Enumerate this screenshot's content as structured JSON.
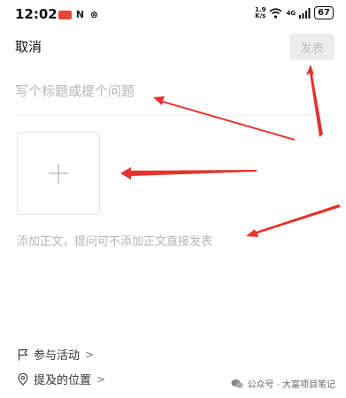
{
  "status_bar": {
    "time": "12:02",
    "notif_n": "N",
    "notif_x": "⊗",
    "speed_top": "1.9",
    "speed_bottom": "K/s",
    "network": "4G",
    "battery": "67"
  },
  "header": {
    "cancel_label": "取消",
    "publish_label": "发表"
  },
  "editor": {
    "title_placeholder": "写个标题或提个问题",
    "body_placeholder": "添加正文，提问可不添加正文直接发表"
  },
  "options": {
    "activity_label": "参与活动",
    "location_label": "提及的位置",
    "chevron": ">"
  },
  "watermark": {
    "text": "公众号 · 大富项目笔记"
  },
  "colors": {
    "annotation_arrow": "#e8312a",
    "publish_bg_disabled": "#ededed",
    "publish_text_disabled": "#bdbdbd",
    "placeholder": "#b5b5b5"
  },
  "icons": {
    "add_image": "plus-icon",
    "activity": "flag-icon",
    "location": "location-pin-icon",
    "watermark": "wechat-icon"
  }
}
